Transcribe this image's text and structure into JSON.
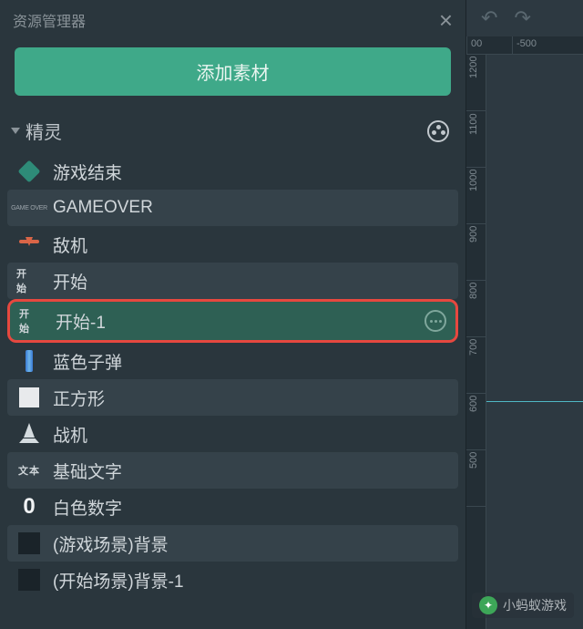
{
  "panel": {
    "title": "资源管理器",
    "add_btn_label": "添加素材"
  },
  "section": {
    "title": "精灵"
  },
  "assets": [
    {
      "label": "游戏结束",
      "icon_name": "cube-icon"
    },
    {
      "label": "GAMEOVER",
      "icon_name": "gameover-text-icon",
      "icon_text": "GAME OVER"
    },
    {
      "label": "敌机",
      "icon_name": "enemy-ship-icon"
    },
    {
      "label": "开始",
      "icon_name": "start-text-icon",
      "icon_text": "开 始"
    },
    {
      "label": "开始-1",
      "icon_name": "start-text-icon",
      "icon_text": "开 始",
      "selected": true
    },
    {
      "label": "蓝色子弹",
      "icon_name": "bullet-icon"
    },
    {
      "label": "正方形",
      "icon_name": "square-icon"
    },
    {
      "label": "战机",
      "icon_name": "fighter-ship-icon"
    },
    {
      "label": "基础文字",
      "icon_name": "text-badge-icon",
      "icon_text": "文本"
    },
    {
      "label": "白色数字",
      "icon_name": "digit-icon",
      "icon_text": "0"
    },
    {
      "label": "(游戏场景)背景",
      "icon_name": "black-square-icon"
    },
    {
      "label": "(开始场景)背景-1",
      "icon_name": "black-square-icon"
    }
  ],
  "ruler_h": [
    "00",
    "-500"
  ],
  "ruler_v": [
    "1200",
    "1100",
    "1000",
    "900",
    "800",
    "700",
    "600",
    "500"
  ],
  "watermark": {
    "text": "小蚂蚁游戏"
  }
}
